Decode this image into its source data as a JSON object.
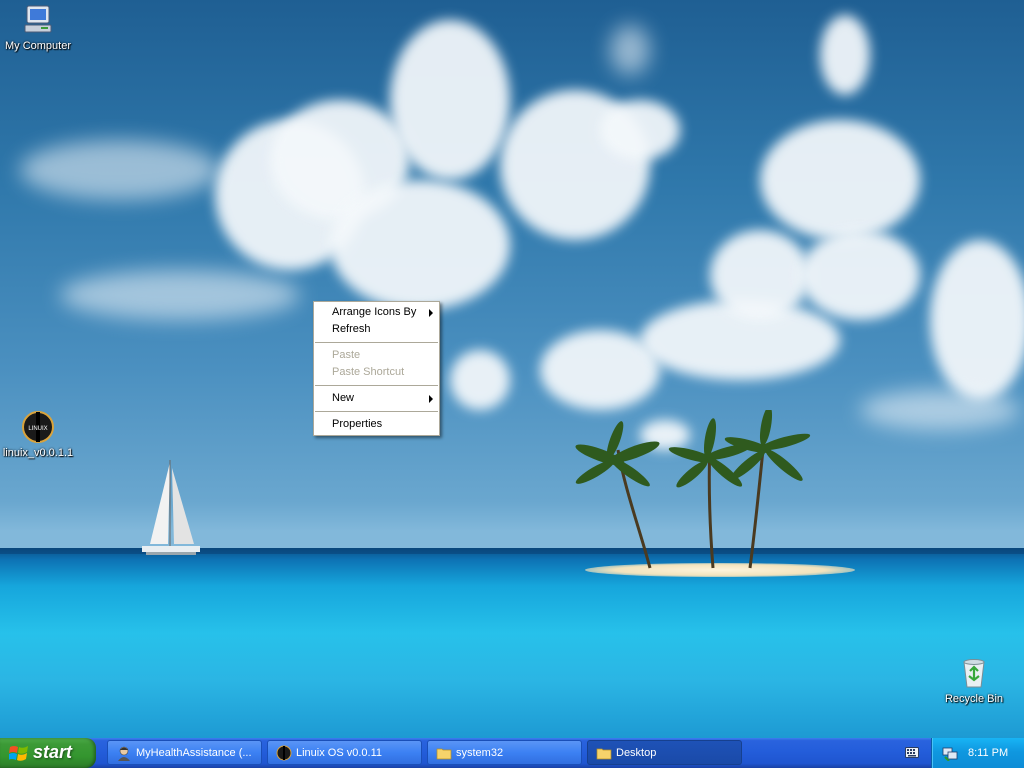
{
  "desktop": {
    "icons": [
      {
        "label": "My Computer",
        "icon": "my-computer-icon"
      },
      {
        "label": "linuix_v0.0.1.1",
        "icon": "linuix-app-icon",
        "icon_text": "LINUIX"
      },
      {
        "label": "Recycle Bin",
        "icon": "recycle-bin-icon"
      }
    ]
  },
  "context_menu": {
    "items": [
      {
        "label": "Arrange Icons By",
        "submenu": true,
        "enabled": true
      },
      {
        "label": "Refresh",
        "submenu": false,
        "enabled": true
      },
      {
        "label": "Paste",
        "submenu": false,
        "enabled": false
      },
      {
        "label": "Paste Shortcut",
        "submenu": false,
        "enabled": false
      },
      {
        "label": "New",
        "submenu": true,
        "enabled": true
      },
      {
        "label": "Properties",
        "submenu": false,
        "enabled": true
      }
    ]
  },
  "taskbar": {
    "start_label": "start",
    "buttons": [
      {
        "label": "MyHealthAssistance (...",
        "icon": "user-avatar-icon"
      },
      {
        "label": "Linuix OS v0.0.11",
        "icon": "linuix-app-icon"
      },
      {
        "label": "system32",
        "icon": "folder-icon"
      },
      {
        "label": "Desktop",
        "icon": "folder-icon"
      }
    ],
    "tray": {
      "clock": "8:11 PM",
      "icons": [
        "keyboard-icon",
        "network-icon"
      ]
    }
  },
  "colors": {
    "taskbar_blue": "#245edb",
    "start_green": "#3c9a37",
    "tray_blue": "#0f98e0",
    "menu_disabled": "#aca899"
  }
}
